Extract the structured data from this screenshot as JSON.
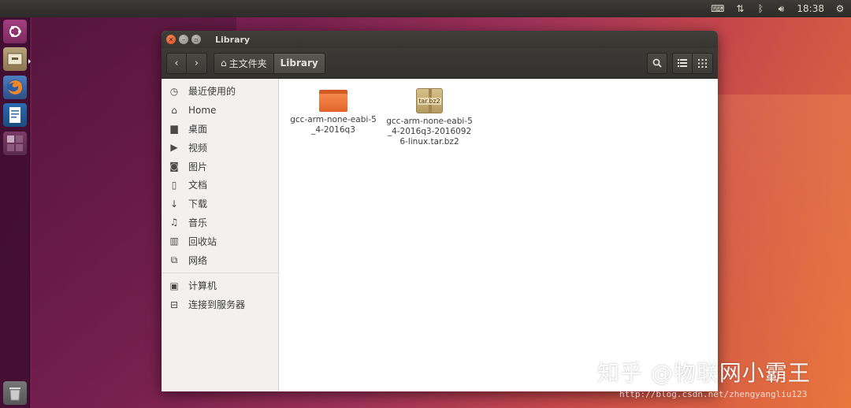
{
  "top_panel": {
    "keyboard_icon": "keyboard-icon",
    "network_icon": "network-updown-icon",
    "bluetooth_icon": "bluetooth-icon",
    "volume_icon": "volume-icon",
    "time": "18:38",
    "settings_icon": "gear-icon"
  },
  "launcher": {
    "items": [
      "ubuntu-dash-icon",
      "files-icon",
      "firefox-icon",
      "writer-icon",
      "workspace-switcher-icon",
      "trash-icon"
    ]
  },
  "window": {
    "title": "Library",
    "breadcrumb": {
      "home_label": "主文件夹",
      "current_label": "Library"
    }
  },
  "sidebar": {
    "items": [
      {
        "label": "最近使用的",
        "icon": "clock-icon",
        "glyph": "◷"
      },
      {
        "label": "Home",
        "icon": "home-icon",
        "glyph": "⌂"
      },
      {
        "label": "桌面",
        "icon": "desktop-folder-icon",
        "glyph": "▆"
      },
      {
        "label": "视频",
        "icon": "video-icon",
        "glyph": "▶"
      },
      {
        "label": "图片",
        "icon": "camera-icon",
        "glyph": "◙"
      },
      {
        "label": "文档",
        "icon": "document-icon",
        "glyph": "▯"
      },
      {
        "label": "下载",
        "icon": "download-icon",
        "glyph": "↓"
      },
      {
        "label": "音乐",
        "icon": "music-icon",
        "glyph": "♫"
      },
      {
        "label": "回收站",
        "icon": "trash-icon",
        "glyph": "▥"
      },
      {
        "label": "网络",
        "icon": "network-icon",
        "glyph": "⧉"
      }
    ],
    "devices": [
      {
        "label": "计算机",
        "icon": "computer-icon",
        "glyph": "▣"
      },
      {
        "label": "连接到服务器",
        "icon": "server-icon",
        "glyph": "⊟"
      }
    ]
  },
  "files": [
    {
      "name": "gcc-arm-none-eabi-5_4-2016q3",
      "type": "folder",
      "icon": "folder-icon"
    },
    {
      "name": "gcc-arm-none-eabi-5_4-2016q3-20160926-linux.tar.bz2",
      "type": "archive",
      "icon": "archive-icon",
      "badge": "tar.bz2"
    }
  ],
  "watermark": {
    "zhihu": "知乎 @物联网小霸王",
    "csdn": "http://blog.csdn.net/zhengyangliu123"
  },
  "colors": {
    "accent_close": "#dd4814",
    "folder": "#e3632a",
    "panel": "#3c3b37"
  }
}
